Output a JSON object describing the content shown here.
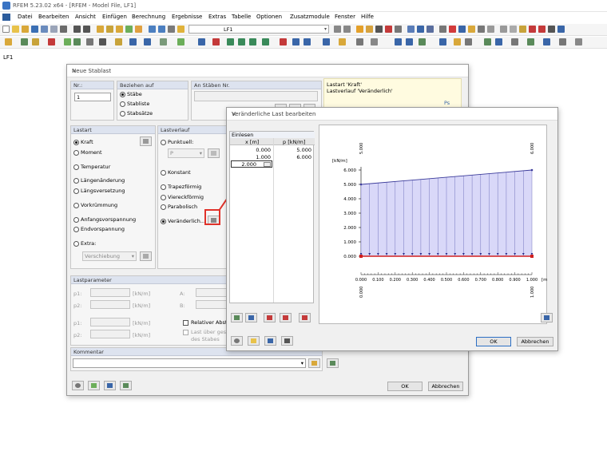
{
  "window": {
    "title": "RFEM 5.23.02 x64 - [RFEM - Model File, LF1]"
  },
  "menu": [
    "Datei",
    "Bearbeiten",
    "Ansicht",
    "Einfügen",
    "Berechnung",
    "Ergebnisse",
    "Extras",
    "Tabelle",
    "Optionen",
    "Zusatzmodule",
    "Fenster",
    "Hilfe"
  ],
  "toolbar": {
    "loadcase": "LF1"
  },
  "canvas_label": "LF1",
  "main_dialog": {
    "title": "Neue Stablast",
    "nr_label": "Nr.:",
    "nr_value": "1",
    "bezug_label": "Beziehen auf",
    "bezug_opts": [
      "Stäbe",
      "Stabliste",
      "Stabsätze"
    ],
    "anstaben_label": "An Stäben Nr.",
    "info_line1": "Lastart 'Kraft'",
    "info_line2": "Lastverlauf 'Veränderlich'",
    "info_ps": "Ps",
    "lastart_label": "Lastart",
    "lastart_opts": [
      "Kraft",
      "Moment",
      "Temperatur",
      "Längenänderung",
      "Längsversetzung",
      "Vorkrümmung",
      "Anfangsvorspannung",
      "Endvorspannung",
      "Extra:"
    ],
    "extra_value": "Verschiebung",
    "lastverlauf_label": "Lastverlauf",
    "lastverlauf_opts": [
      "Punktuell:",
      "Konstant",
      "Trapezförmig",
      "Viereckförmig",
      "Parabolisch",
      "Veränderlich..."
    ],
    "punktuell_value": "P",
    "lastparam_label": "Lastparameter",
    "p1": "p1:",
    "p2": "p2:",
    "p3": "p1:",
    "p4": "p2:",
    "unit": "[kN/m]",
    "a": "A:",
    "b": "B:",
    "relativer": "Relativer Abstand",
    "lastueber": "Last über gesamte",
    "desstabes": "des Stabes",
    "kommentar_label": "Kommentar",
    "ok": "OK",
    "abbrechen": "Abbrechen"
  },
  "sub_dialog": {
    "title": "Veränderliche Last bearbeiten",
    "einlesen": "Einlesen",
    "col_x": "x [m]",
    "col_p": "p [kN/m]",
    "rows": [
      {
        "x": "0.000",
        "p": "5.000"
      },
      {
        "x": "1.000",
        "p": "6.000"
      },
      {
        "x": "2.000",
        "p": ""
      }
    ],
    "ok": "OK",
    "abbrechen": "Abbrechen"
  },
  "chart_data": {
    "type": "area",
    "ylabel": "[kN/m]",
    "xlabel": "[m]",
    "yticks": [
      "6.000",
      "5.000",
      "4.000",
      "3.000",
      "2.000",
      "1.000",
      "0.000"
    ],
    "xticks": [
      "0.000",
      "0.100",
      "0.200",
      "0.300",
      "0.400",
      "0.500",
      "0.600",
      "0.700",
      "0.800",
      "0.900",
      "1.000"
    ],
    "x": [
      0.0,
      1.0
    ],
    "y": [
      5.0,
      6.0
    ],
    "xlim": [
      0,
      1
    ],
    "ylim": [
      0,
      6
    ],
    "annot_top_left": "5.000",
    "annot_top_right": "6.000",
    "annot_bot_left": "0.000",
    "annot_bot_right": "1.000",
    "fill_color": "#d9d8f8",
    "line_color": "#3a3a9a"
  }
}
